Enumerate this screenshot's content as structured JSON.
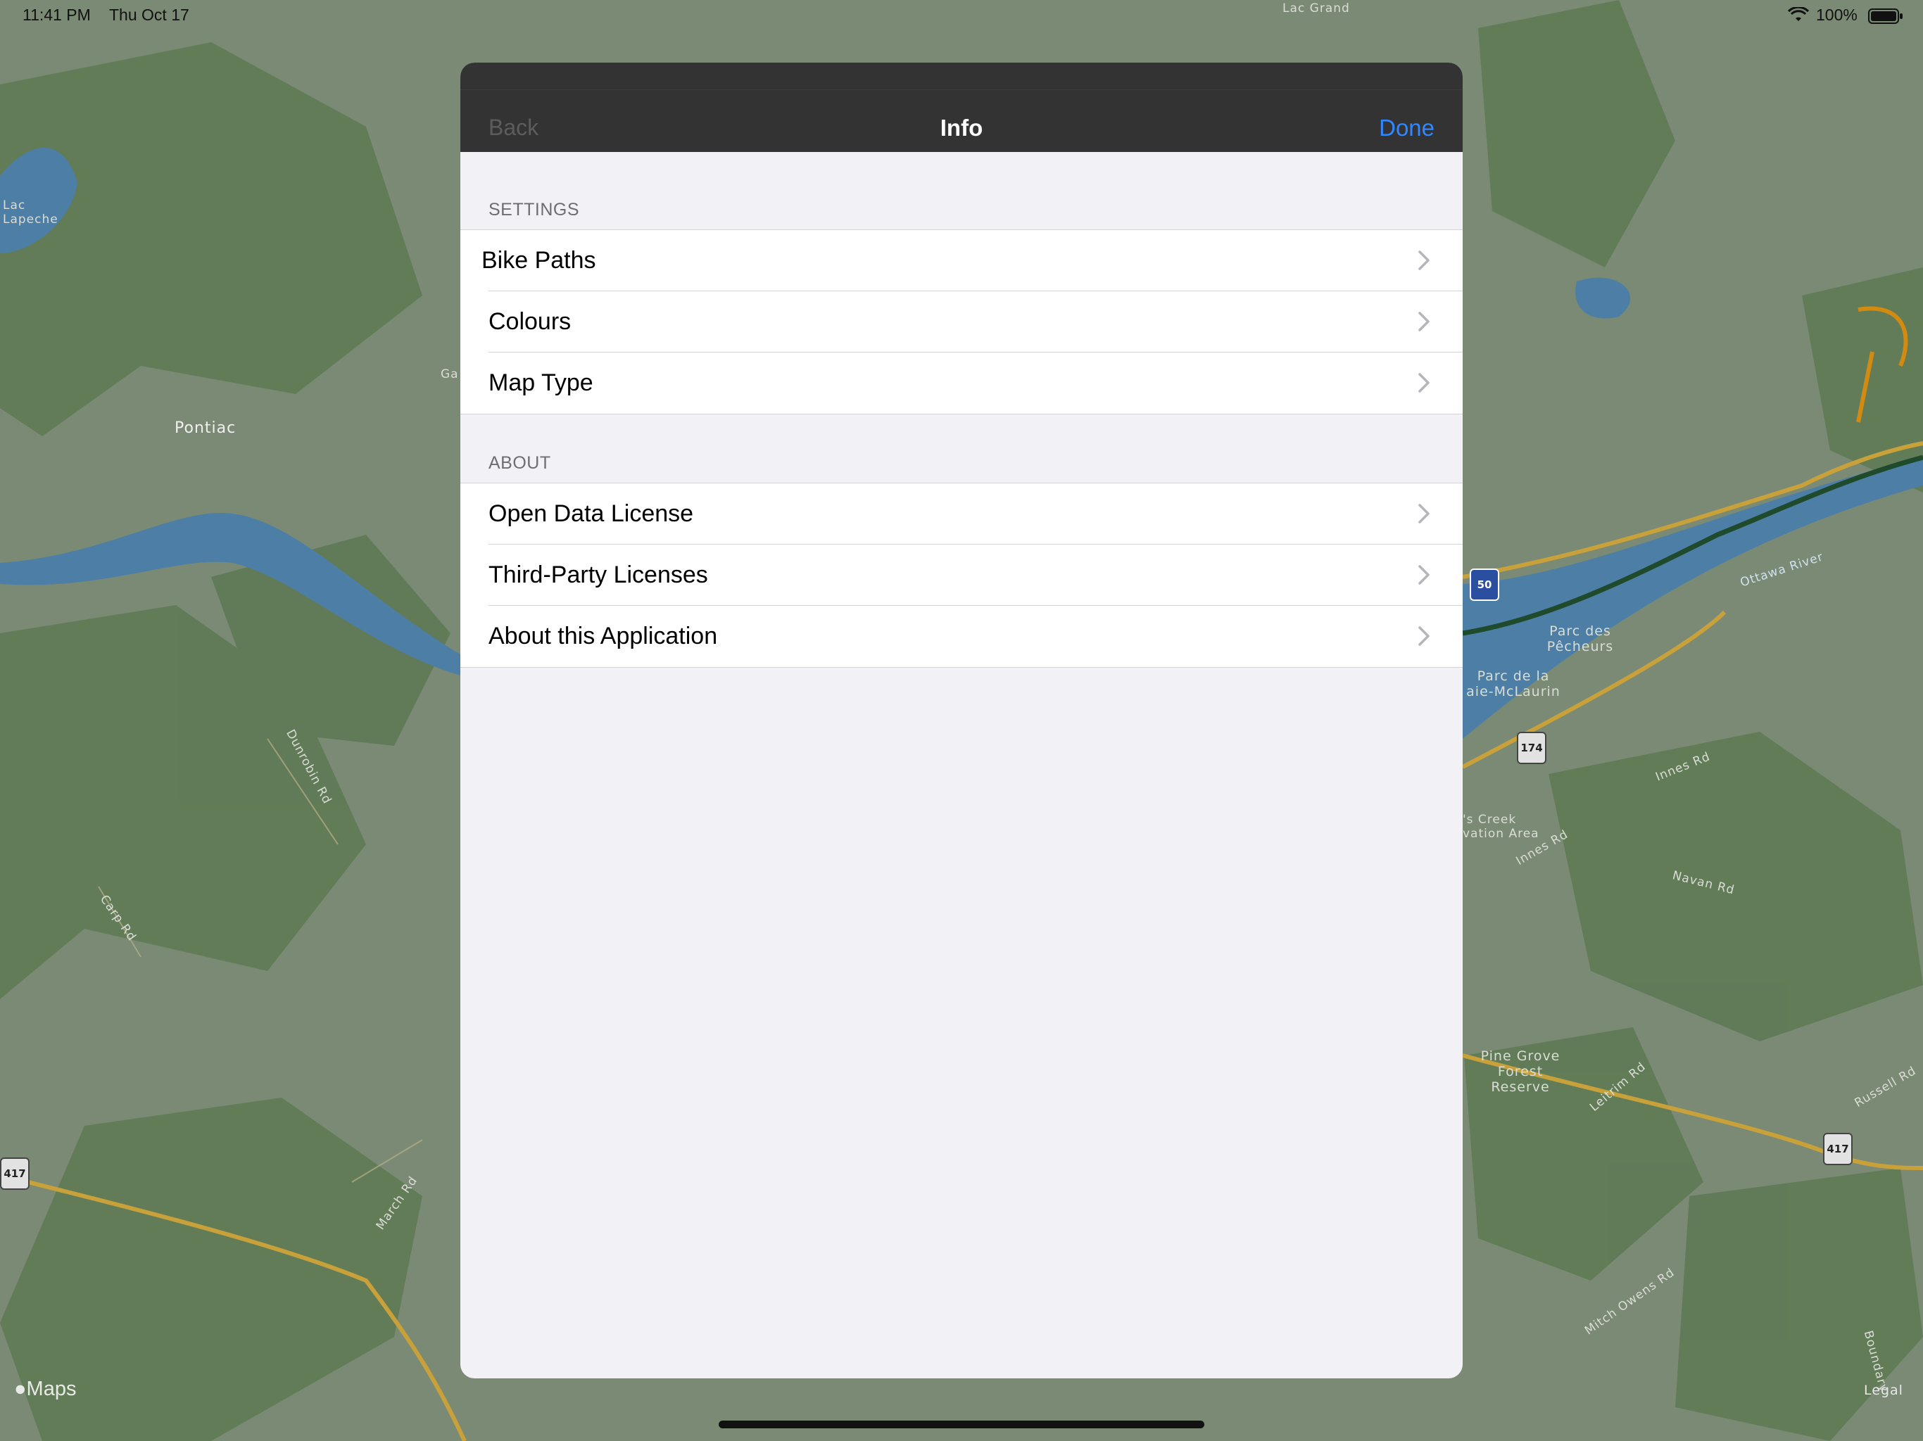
{
  "status_bar": {
    "time": "11:41 PM",
    "date": "Thu Oct 17",
    "battery_percent": "100%",
    "wifi_icon": "wifi-icon",
    "battery_icon": "battery-icon"
  },
  "map": {
    "labels": [
      {
        "text": "Lac Grand",
        "name": "map-label-lac-grand"
      },
      {
        "text": "Lac Lapeche",
        "name": "map-label-lac-lapeche"
      },
      {
        "text": "Pontiac",
        "name": "map-label-pontiac"
      },
      {
        "text": "Ga",
        "name": "map-label-ga"
      },
      {
        "text": "Dunrobin Rd",
        "name": "map-label-dunrobin-rd"
      },
      {
        "text": "Carp Rd",
        "name": "map-label-carp-rd"
      },
      {
        "text": "March Rd",
        "name": "map-label-march-rd"
      },
      {
        "text": "Ottawa River",
        "name": "map-label-ottawa-river"
      },
      {
        "text": "Parc des Pêcheurs",
        "name": "map-label-parc-des-pecheurs"
      },
      {
        "text": "Parc de la aie-McLaurin",
        "name": "map-label-parc-mclaurin"
      },
      {
        "text": "Innes Rd",
        "name": "map-label-innes-rd-1"
      },
      {
        "text": "Innes Rd",
        "name": "map-label-innes-rd-2"
      },
      {
        "text": "'s Creek vation Area",
        "name": "map-label-creek-area"
      },
      {
        "text": "Navan Rd",
        "name": "map-label-navan-rd"
      },
      {
        "text": "Pine Grove Forest Reserve",
        "name": "map-label-pine-grove"
      },
      {
        "text": "Leitrim Rd",
        "name": "map-label-leitrim-rd"
      },
      {
        "text": "Russell Rd",
        "name": "map-label-russell-rd"
      },
      {
        "text": "Mitch Owens Rd",
        "name": "map-label-mitch-owens-rd"
      },
      {
        "text": "Boundary",
        "name": "map-label-boundary"
      }
    ],
    "shields": {
      "hwy417": "417",
      "hwy174": "174",
      "hwy50": "50"
    },
    "attribution": "Maps",
    "legal": "Legal",
    "colors": {
      "forest": "#5f7a55",
      "land": "#7a8a74",
      "water": "#4d7fa6",
      "road": "#c9a13a",
      "bikepath": "#1f4a2c"
    }
  },
  "modal": {
    "nav": {
      "back_label": "Back",
      "title": "Info",
      "done_label": "Done"
    },
    "settings": {
      "header": "SETTINGS",
      "items": [
        {
          "label": "Bike Paths"
        },
        {
          "label": "Colours"
        },
        {
          "label": "Map Type"
        }
      ]
    },
    "about": {
      "header": "ABOUT",
      "items": [
        {
          "label": "Open Data License"
        },
        {
          "label": "Third-Party Licenses"
        },
        {
          "label": "About this Application"
        }
      ]
    },
    "chevron_icon": "chevron-right-icon",
    "accent_color": "#2f88ff"
  }
}
